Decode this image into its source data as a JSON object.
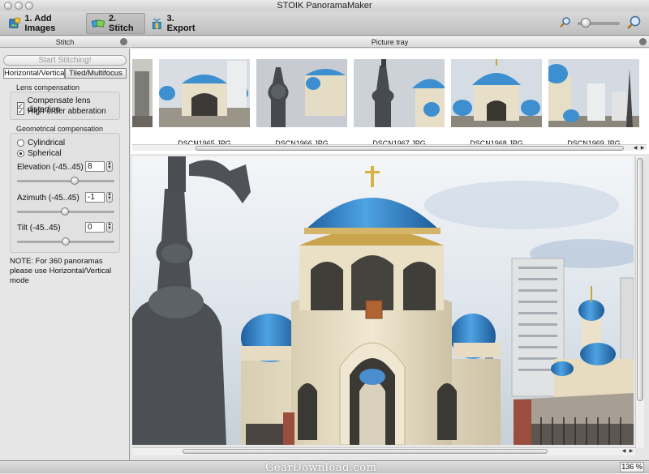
{
  "window": {
    "title": "STOIK PanoramaMaker"
  },
  "toolbar": {
    "steps": [
      {
        "label": "1. Add Images",
        "icon": "add-images-icon"
      },
      {
        "label": "2. Stitch",
        "icon": "stitch-icon"
      },
      {
        "label": "3. Export",
        "icon": "export-icon"
      }
    ],
    "active_step": 1,
    "zoom_level": 0.2
  },
  "left_panel": {
    "title": "Stitch",
    "start_button": "Start Stitching!",
    "tabs": [
      "Horizontal/Vertical",
      "Tiled/Multifocus"
    ],
    "selected_tab": 0,
    "lens": {
      "title": "Lens compensation",
      "options": [
        {
          "label": "Compensate lens distortion",
          "checked": true
        },
        {
          "label": "High order abberation",
          "checked": true
        }
      ]
    },
    "geometry": {
      "title": "Geometrical compensation",
      "modes": [
        "Cylindrical",
        "Spherical"
      ],
      "selected_mode": 1,
      "params": [
        {
          "label": "Elevation (-45..45)",
          "value": "8",
          "fraction": 0.59
        },
        {
          "label": "Azimuth (-45..45)",
          "value": "-1",
          "fraction": 0.49
        },
        {
          "label": "Tilt (-45..45)",
          "value": "0",
          "fraction": 0.5
        }
      ]
    },
    "note": "NOTE: For 360 panoramas please use Horizontal/Vertical mode"
  },
  "tray": {
    "title": "Picture tray",
    "thumbnails": [
      "DSCN1965.JPG",
      "DSCN1966.JPG",
      "DSCN1967.JPG",
      "DSCN1968.JPG",
      "DSCN1969.JPG"
    ]
  },
  "status": {
    "watermark": "GearDownload.com",
    "zoom": "136 %"
  }
}
